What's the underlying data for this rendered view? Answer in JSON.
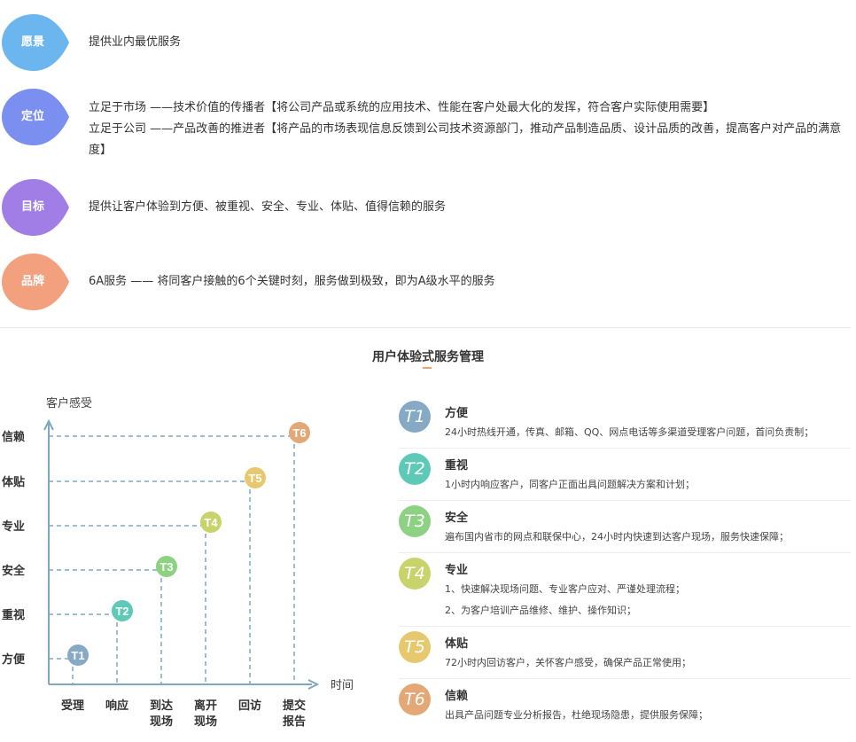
{
  "top": [
    {
      "label": "愿景",
      "color": "#6cb6ef",
      "lines": [
        "提供业内最优服务"
      ]
    },
    {
      "label": "定位",
      "color": "#7a8fef",
      "lines": [
        "立足于市场 ——技术价值的传播者【将公司产品或系统的应用技术、性能在客户处最大化的发挥，符合客户实际使用需要】",
        "立足于公司 ——产品改善的推进者【将产品的市场表现信息反馈到公司技术资源部门，推动产品制造品质、设计品质的改善，提高客户对产品的满意度】"
      ]
    },
    {
      "label": "目标",
      "color": "#a07ee6",
      "lines": [
        "提供让客户体验到方便、被重视、安全、专业、体贴、值得信赖的服务"
      ]
    },
    {
      "label": "品牌",
      "color": "#f2a07e",
      "lines": [
        "6A服务 —— 将同客户接触的6个关键时刻，服务做到极致，即为A级水平的服务"
      ]
    }
  ],
  "section_title": "用户体验式服务管理",
  "chart_data": {
    "type": "diagram",
    "ylabel": "客户感受",
    "xlabel": "时间",
    "y_levels": [
      "方便",
      "重视",
      "安全",
      "专业",
      "体贴",
      "信赖"
    ],
    "x_steps": [
      "受理",
      "响应",
      "到达\n现场",
      "离开\n现场",
      "回访",
      "提交\n报告"
    ],
    "points": [
      {
        "label": "T1",
        "x": 0,
        "y": 0,
        "color": "#86a9c6"
      },
      {
        "label": "T2",
        "x": 1,
        "y": 1,
        "color": "#5fc9b8"
      },
      {
        "label": "T3",
        "x": 2,
        "y": 2,
        "color": "#8dd283"
      },
      {
        "label": "T4",
        "x": 3,
        "y": 3,
        "color": "#c8d36c"
      },
      {
        "label": "T5",
        "x": 4,
        "y": 4,
        "color": "#e8c86e"
      },
      {
        "label": "T6",
        "x": 5,
        "y": 5,
        "color": "#e3a875"
      }
    ]
  },
  "items": [
    {
      "tag": "T1",
      "title": "方便",
      "color": "#86a9c6",
      "desc": [
        "24小时热线开通，传真、邮箱、QQ、网点电话等多渠道受理客户问题，首问负责制；"
      ]
    },
    {
      "tag": "T2",
      "title": "重视",
      "color": "#5fc9b8",
      "desc": [
        "1小时内响应客户，同客户正面出具问题解决方案和计划；"
      ]
    },
    {
      "tag": "T3",
      "title": "安全",
      "color": "#8dd283",
      "desc": [
        "遍布国内省市的网点和联保中心，24小时内快速到达客户现场，服务快速保障；"
      ]
    },
    {
      "tag": "T4",
      "title": "专业",
      "color": "#c8d36c",
      "desc": [
        "1、快速解决现场问题、专业客户应对、严谨处理流程；",
        "2、为客户培训产品维修、维护、操作知识；"
      ]
    },
    {
      "tag": "T5",
      "title": "体贴",
      "color": "#e8c86e",
      "desc": [
        "72小时内回访客户，关怀客户感受，确保产品正常使用；"
      ]
    },
    {
      "tag": "T6",
      "title": "信赖",
      "color": "#e3a875",
      "desc": [
        "出具产品问题专业分析报告，杜绝现场隐患，提供服务保障；"
      ]
    }
  ]
}
